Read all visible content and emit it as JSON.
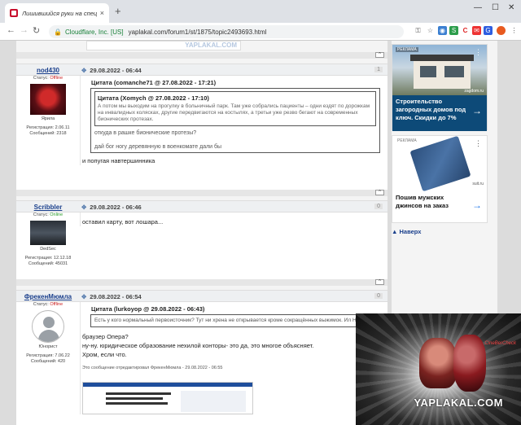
{
  "browser": {
    "tab_title": "Лишившийся руки на спецопер",
    "tab_close": "×",
    "new_tab": "+",
    "security_label": "Cloudflare, Inc. [US]",
    "url": "yaplakal.com/forum1/st/1875/topic2493693.html",
    "window_controls": [
      "—",
      "☐",
      "✕"
    ]
  },
  "forum": {
    "scrap_watermark": "YAPLAKAL.COM",
    "posts": [
      {
        "username": "nod430",
        "date": "29.08.2022 - 06:44",
        "number": "1",
        "status_label": "Статус:",
        "status": "Offline",
        "rank": "Ярила",
        "reg": "Регистрация: 2.06.11",
        "msgs": "Сообщений: 2318",
        "quote_header": "Цитата (comanche71 @ 27.08.2022 - 17:21)",
        "inner_quote_header": "Цитата (Xomych @ 27.08.2022 - 17:10)",
        "inner_quote_text": "А потом мы выходим на прогулку в больничный парк. Там уже собрались пациенты – одни ездят по дорожкам на инвалидных колясках, другие передвигаются на костылях, а третьи уже резво бегают на современных бионических протезах.",
        "quote_text_1": "откуда в рашке бионические протезы?",
        "quote_text_2": "дай бог ногу деревянную в военкомате дали бы",
        "text": "и попугая навтершинника"
      },
      {
        "username": "Scribbler",
        "date": "29.08.2022 - 06:46",
        "number": "0",
        "status_label": "Статус:",
        "status": "Online",
        "rank": "DedSec",
        "reg": "Регистрация: 12.12.18",
        "msgs": "Сообщений: 45031",
        "text": "оставил карту, вот лошара..."
      },
      {
        "username": "ФрекенМюмла",
        "date": "29.08.2022 - 06:54",
        "number": "0",
        "status_label": "Статус:",
        "status": "Offline",
        "rank": "Юнорист",
        "reg": "Регистрация: 7.06.22",
        "msgs": "Сообщений: 420",
        "quote_header": "Цитата (lurkoyop @ 29.08.2022 - 06:43)",
        "quote_text": "Есть у кого нормальный первоисточник? Тут ни хрена не открывается кроме сокращённых выжимок. Ил Но зачем?",
        "lines": [
          "браузер Опера?",
          "ну-ну. юридическое образование нехилой конторы- это да, это многое объясняет.",
          "Хром, если что."
        ],
        "edited_note": "Это сообщение отредактировал ФрекенМюмла - 29.08.2022 - 06:55"
      }
    ],
    "up_symbol": "^"
  },
  "ads": {
    "ad_label": "РЕКЛАМА",
    "ad1_caption": "Строительство загородных домов под ключ. Скидки до 7%",
    "ad1_domain": "zagdom.ru",
    "ad2_caption": "Пошив мужских джинсов на заказ",
    "ad2_domain": "suit.ru",
    "nav_up": "Наверх"
  },
  "video": {
    "watermark": "YAPLAKAL.COM",
    "brand": "CineBerCheck"
  }
}
